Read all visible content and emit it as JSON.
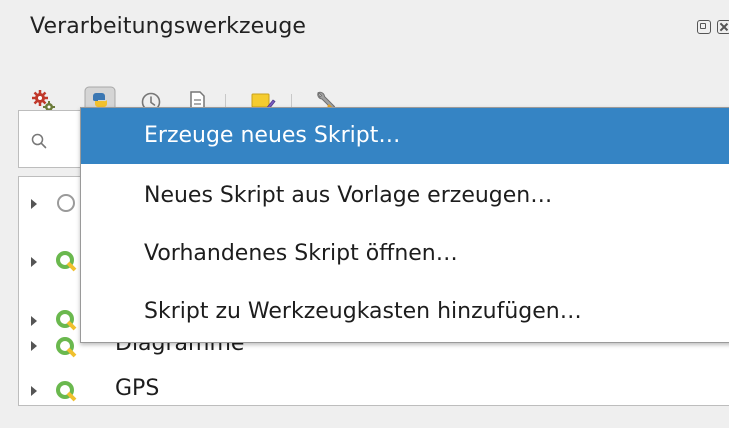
{
  "panel": {
    "title": "Verarbeitungswerkzeuge"
  },
  "toolbar": {
    "buttons": [
      {
        "icon": "gears-icon"
      },
      {
        "icon": "python-icon"
      },
      {
        "icon": "history-clock-icon"
      },
      {
        "icon": "results-document-icon"
      },
      {
        "icon": "edit-in-place-icon"
      },
      {
        "icon": "options-wrench-icon"
      }
    ]
  },
  "search": {
    "icon": "search-icon"
  },
  "tree": {
    "items": [
      {
        "label": "",
        "icon": "gear-icon"
      },
      {
        "label": "",
        "icon": "qgis-icon"
      },
      {
        "label": "",
        "icon": "qgis-icon"
      },
      {
        "label": "Diagramme",
        "icon": "qgis-icon"
      },
      {
        "label": "GPS",
        "icon": "qgis-icon"
      }
    ]
  },
  "menu": {
    "items": [
      {
        "label": "Erzeuge neues Skript…",
        "active": true
      },
      {
        "label": "Neues Skript aus Vorlage erzeugen…",
        "active": false
      },
      {
        "label": "Vorhandenes Skript öffnen…",
        "active": false
      },
      {
        "label": "Skript zu Werkzeugkasten hinzufügen…",
        "active": false
      }
    ]
  },
  "colors": {
    "highlight": "#3584c4",
    "qgis_green": "#6ab84e",
    "python_blue": "#3b77b2",
    "python_yellow": "#f2c12e"
  }
}
